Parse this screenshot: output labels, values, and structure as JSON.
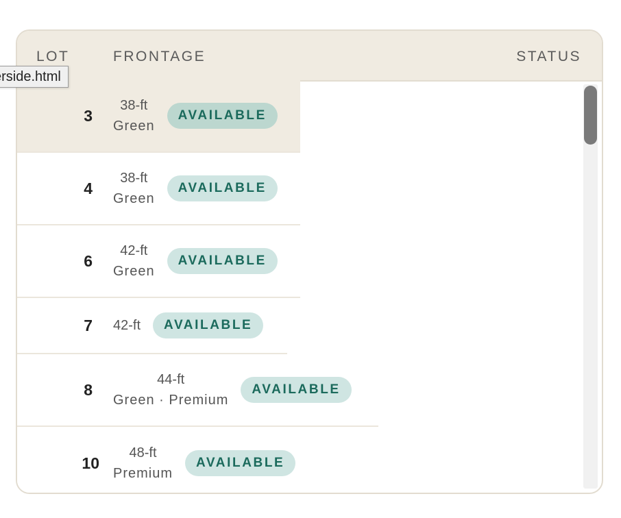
{
  "table": {
    "headers": {
      "lot": "LOT",
      "frontage": "FRONTAGE",
      "status": "STATUS"
    },
    "rows": [
      {
        "lot": "3",
        "size": "38-ft",
        "desc": "Green",
        "status": "AVAILABLE",
        "selected": true
      },
      {
        "lot": "4",
        "size": "38-ft",
        "desc": "Green",
        "status": "AVAILABLE",
        "selected": false
      },
      {
        "lot": "6",
        "size": "42-ft",
        "desc": "Green",
        "status": "AVAILABLE",
        "selected": false
      },
      {
        "lot": "7",
        "size": "42-ft",
        "desc": "",
        "status": "AVAILABLE",
        "selected": false
      },
      {
        "lot": "8",
        "size": "44-ft",
        "desc": "Green · Premium",
        "status": "AVAILABLE",
        "selected": false
      },
      {
        "lot": "10",
        "size": "48-ft",
        "desc": "Premium",
        "status": "AVAILABLE",
        "selected": false
      }
    ]
  },
  "tooltip": {
    "text": "erside.html"
  },
  "colors": {
    "header_bg": "#f0ebe1",
    "badge_bg": "#cfe5e2",
    "badge_text": "#1b6a5c",
    "border": "#e2dcd0"
  }
}
